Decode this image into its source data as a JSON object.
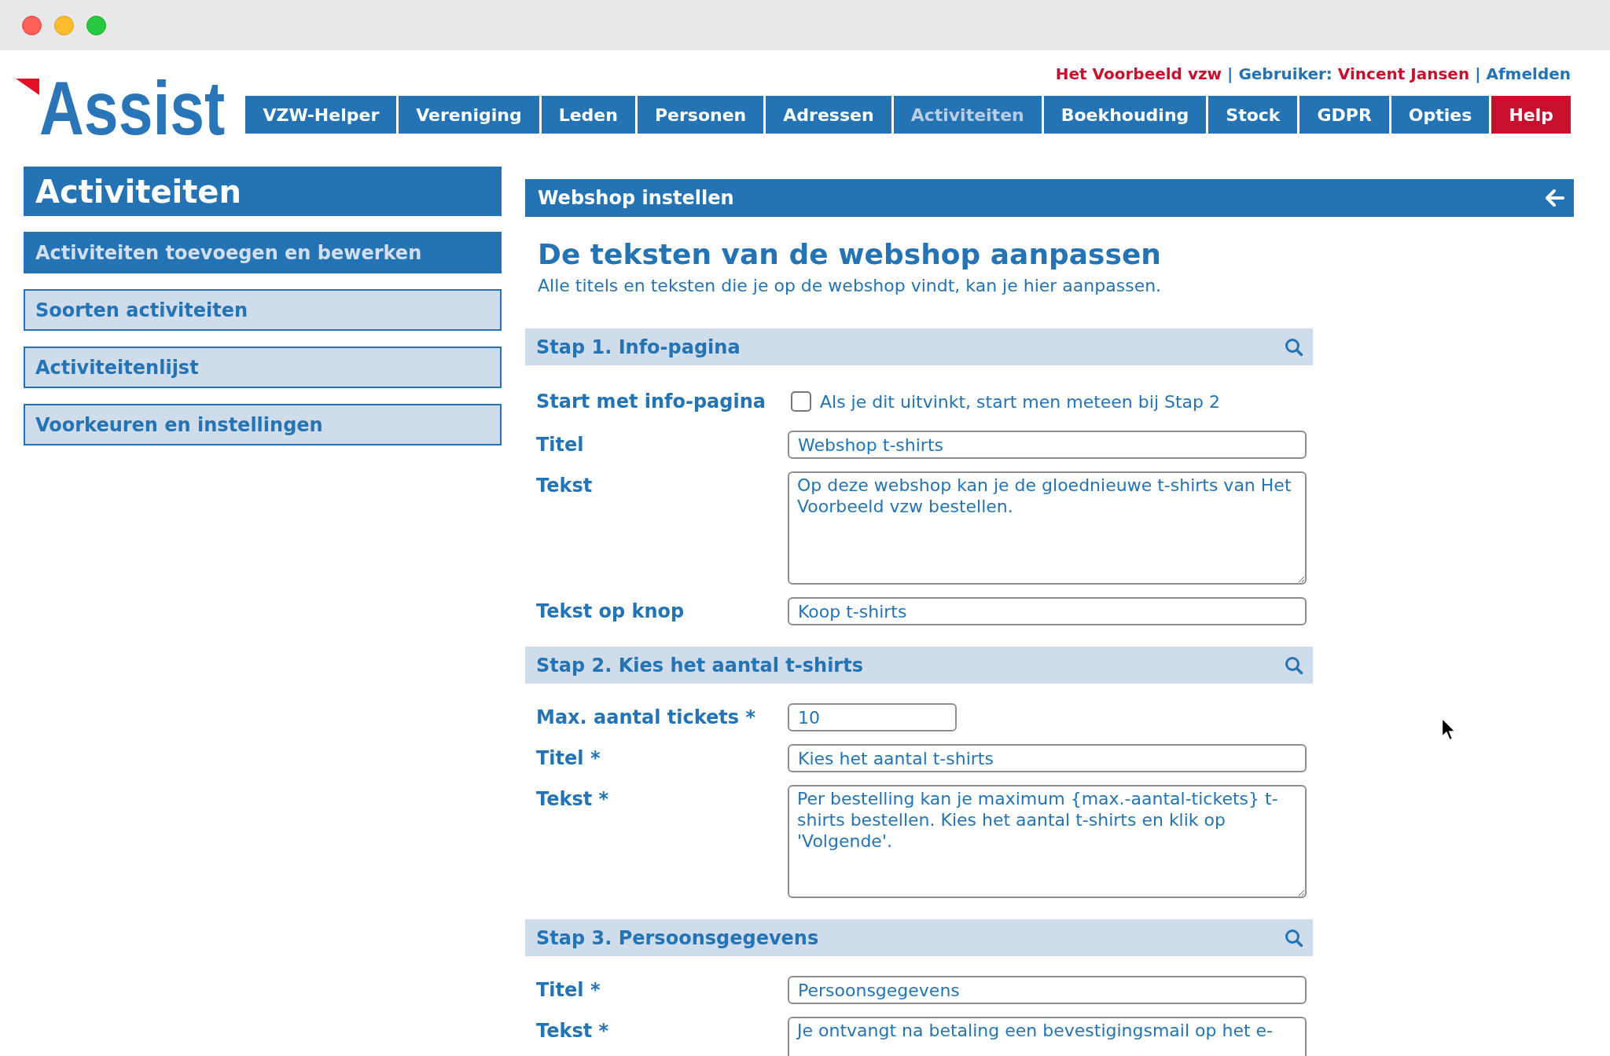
{
  "logo": {
    "text": "Assist"
  },
  "account_bar": [
    {
      "kind": "organization",
      "text": "Het Voorbeeld vzw"
    },
    {
      "kind": "separator",
      "text": "|"
    },
    {
      "kind": "label",
      "text": "Gebruiker:"
    },
    {
      "kind": "user",
      "text": "Vincent Jansen"
    },
    {
      "kind": "separator",
      "text": "|"
    },
    {
      "kind": "link",
      "text": "Afmelden"
    }
  ],
  "nav": [
    {
      "label": "VZW-Helper",
      "kind": "menu",
      "selected": false
    },
    {
      "label": "Vereniging",
      "kind": "menu",
      "selected": false
    },
    {
      "label": "Leden",
      "kind": "menu",
      "selected": false
    },
    {
      "label": "Personen",
      "kind": "menu",
      "selected": false
    },
    {
      "label": "Adressen",
      "kind": "menu",
      "selected": false
    },
    {
      "label": "Activiteiten",
      "kind": "menu",
      "selected": true
    },
    {
      "label": "Boekhouding",
      "kind": "menu",
      "selected": false
    },
    {
      "label": "Stock",
      "kind": "menu",
      "selected": false
    },
    {
      "label": "GDPR",
      "kind": "menu",
      "selected": false
    },
    {
      "label": "Opties",
      "kind": "menu",
      "selected": false
    },
    {
      "label": "Help",
      "kind": "help",
      "selected": false
    }
  ],
  "sidebar": {
    "title": "Activiteiten",
    "items": [
      {
        "label": "Activiteiten toevoegen en bewerken",
        "selected": true
      },
      {
        "label": "Soorten activiteiten",
        "selected": false
      },
      {
        "label": "Activiteitenlijst",
        "selected": false
      },
      {
        "label": "Voorkeuren en instellingen",
        "selected": false
      }
    ]
  },
  "panel": {
    "title": "Webshop instellen",
    "heading": "De teksten van de webshop aanpassen",
    "intro": "Alle titels en teksten die je op de webshop vindt, kan je hier aanpassen.",
    "sections": [
      {
        "title": "Stap 1. Info-pagina",
        "fields": [
          {
            "kind": "checkbox",
            "label": "Start met info-pagina",
            "checked": false,
            "text": "Als je dit uitvinkt, start men meteen bij Stap 2"
          },
          {
            "kind": "text",
            "label": "Titel",
            "value": "Webshop t-shirts"
          },
          {
            "kind": "textarea",
            "label": "Tekst",
            "value": "Op deze webshop kan je de gloednieuwe t-shirts van Het Voorbeeld vzw bestellen."
          },
          {
            "kind": "text",
            "label": "Tekst op knop",
            "value": "Koop t-shirts"
          }
        ]
      },
      {
        "title": "Stap 2. Kies het aantal t-shirts",
        "fields": [
          {
            "kind": "number",
            "label": "Max. aantal tickets *",
            "value": "10"
          },
          {
            "kind": "text",
            "label": "Titel *",
            "value": "Kies het aantal t-shirts"
          },
          {
            "kind": "textarea",
            "label": "Tekst *",
            "value": "Per bestelling kan je maximum {max.-aantal-tickets} t-shirts bestellen. Kies het aantal t-shirts en klik op 'Volgende'."
          }
        ]
      },
      {
        "title": "Stap 3. Persoonsgegevens",
        "fields": [
          {
            "kind": "text",
            "label": "Titel *",
            "value": "Persoonsgegevens"
          },
          {
            "kind": "textarea",
            "label": "Tekst *",
            "value": "Je ontvangt na betaling een bevestigingsmail op het e-"
          }
        ]
      }
    ]
  }
}
